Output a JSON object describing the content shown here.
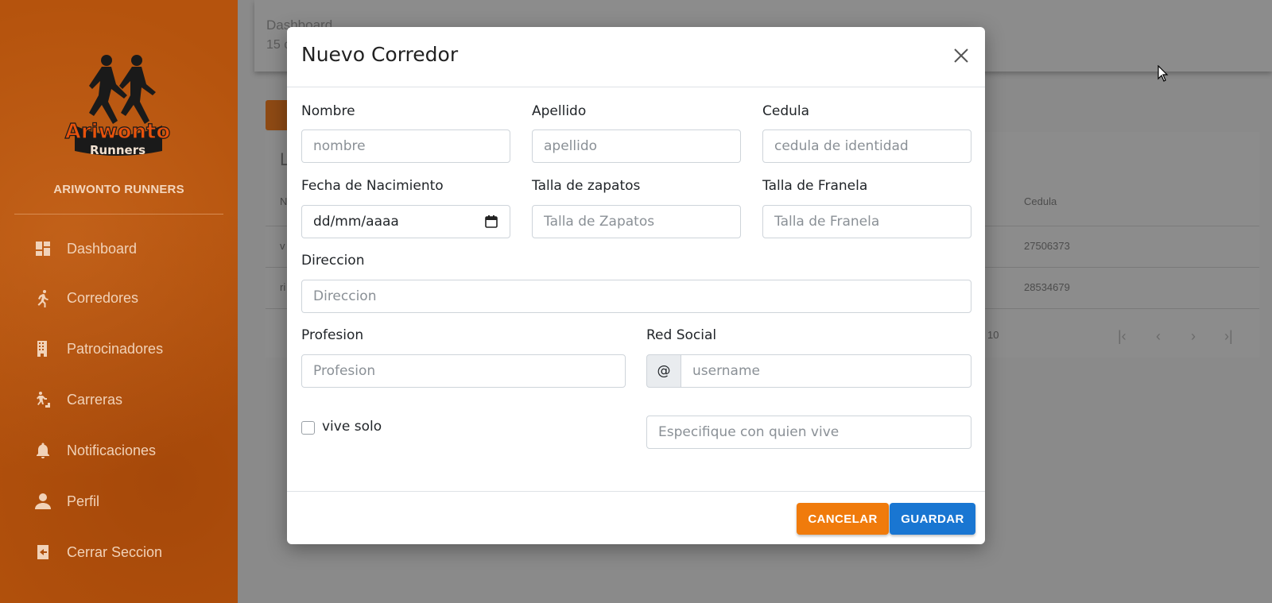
{
  "sidebar": {
    "brand": "ARIWONTO RUNNERS",
    "logo_text_top": "Ariwonto",
    "logo_text_bottom": "Runners",
    "items": [
      {
        "label": "Dashboard",
        "icon": "dashboard-icon"
      },
      {
        "label": "Corredores",
        "icon": "runner-icon"
      },
      {
        "label": "Patrocinadores",
        "icon": "building-icon"
      },
      {
        "label": "Carreras",
        "icon": "stairs-runner-icon"
      },
      {
        "label": "Notificaciones",
        "icon": "bell-icon"
      },
      {
        "label": "Perfil",
        "icon": "person-icon"
      },
      {
        "label": "Cerrar Seccion",
        "icon": "logout-icon"
      }
    ]
  },
  "background": {
    "breadcrumb": "Dashboard",
    "subtitle": "15 c",
    "table_title": "L",
    "col_first": "N",
    "col_cedula": "Cedula",
    "rows": [
      {
        "first": "v",
        "cedula": "27506373"
      },
      {
        "first": "ri",
        "cedula": "28534679"
      }
    ],
    "rows_per_page": "10"
  },
  "modal": {
    "title": "Nuevo Corredor",
    "fields": {
      "nombre": {
        "label": "Nombre",
        "placeholder": "nombre"
      },
      "apellido": {
        "label": "Apellido",
        "placeholder": "apellido"
      },
      "cedula": {
        "label": "Cedula",
        "placeholder": "cedula de identidad"
      },
      "fecha": {
        "label": "Fecha de Nacimiento",
        "value": "dd/mm/aaaa"
      },
      "zapatos": {
        "label": "Talla de zapatos",
        "placeholder": "Talla de Zapatos"
      },
      "franela": {
        "label": "Talla de Franela",
        "placeholder": "Talla de Franela"
      },
      "direccion": {
        "label": "Direccion",
        "placeholder": "Direccion"
      },
      "profesion": {
        "label": "Profesion",
        "placeholder": "Profesion"
      },
      "red_social": {
        "label": "Red Social",
        "addon": "@",
        "placeholder": "username"
      },
      "vive_solo": {
        "label": "vive solo"
      },
      "quien_vive": {
        "placeholder": "Especifique con quien vive"
      }
    },
    "buttons": {
      "cancel": "CANCELAR",
      "save": "GUARDAR"
    }
  },
  "colors": {
    "sidebar": "#b5530d",
    "cancel": "#f07b0c",
    "save": "#1976d2"
  }
}
